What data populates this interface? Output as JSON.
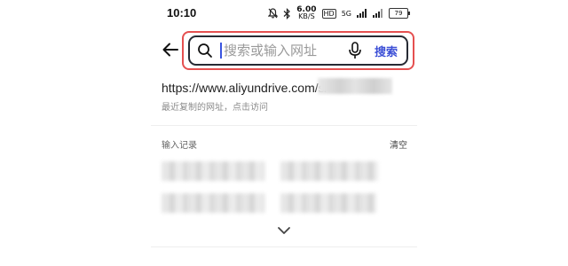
{
  "status_bar": {
    "time": "10:10",
    "net_speed_value": "6.00",
    "net_speed_unit": "KB/S",
    "hd_label": "HD",
    "signal_label": "5G",
    "battery": "79"
  },
  "search": {
    "placeholder": "搜索或输入网址",
    "value": "",
    "button_label": "搜索"
  },
  "recent": {
    "url_prefix": "https://www.aliyundrive.com/s/",
    "hint": "最近复制的网址，点击访问"
  },
  "history": {
    "title": "输入记录",
    "clear_label": "清空"
  },
  "colors": {
    "highlight": "#e55050",
    "accent": "#3c4fd6"
  },
  "icons": [
    "back-arrow-icon",
    "search-icon",
    "microphone-icon",
    "chevron-down-icon",
    "bell-mute-icon",
    "bluetooth-icon"
  ]
}
